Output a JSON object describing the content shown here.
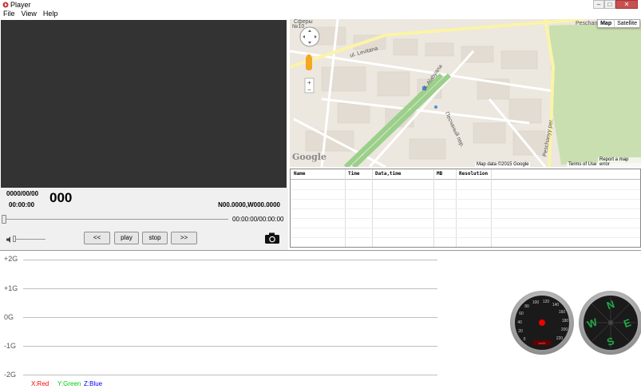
{
  "window": {
    "title": "Player",
    "icon": "player-app-icon",
    "controls": [
      "minimize",
      "maximize",
      "close"
    ]
  },
  "menu": {
    "items": [
      "File",
      "View",
      "Help"
    ]
  },
  "overlay": {
    "date": "0000/00/00",
    "time": "00:00:00",
    "counter": "000",
    "coords": "N00.0000,W000.0000"
  },
  "playback": {
    "timecode": "00:00:00/00:00:00",
    "prev_label": "<<",
    "play_label": "play",
    "stop_label": "stop",
    "next_label": ">>",
    "volume_icon": "speaker-icon",
    "snapshot_icon": "camera-icon"
  },
  "map": {
    "type_map": "Map",
    "type_satellite": "Satellite",
    "logo": "Google",
    "data_credit": "Map data ©2015 Google",
    "terms": "Terms of Use",
    "report": "Report a map error",
    "labels": {
      "street1": "ul. Levitana",
      "street2": "ul. Alabyana",
      "street3": "Песчаный пер.",
      "street4": "Peschanyy per.",
      "street5": "Peschanaya",
      "street6": "Сферы",
      "street7": "№10"
    }
  },
  "table": {
    "columns": [
      "Name",
      "Time",
      "Data,time",
      "MB",
      "Resolution"
    ]
  },
  "gsensor": {
    "labels": [
      "+2G",
      "+1G",
      "0G",
      "-1G",
      "-2G"
    ],
    "legend": [
      {
        "text": "X:Red",
        "color": "#ff0000"
      },
      {
        "text": "Y:Green",
        "color": "#00cc00"
      },
      {
        "text": "Z:Blue",
        "color": "#0000ff"
      }
    ]
  },
  "speedometer": {
    "ticks": [
      "0",
      "20",
      "40",
      "60",
      "80",
      "100",
      "120",
      "140",
      "160",
      "180",
      "200",
      "220"
    ],
    "unit": "km/h"
  },
  "compass": {
    "letters": [
      "N",
      "E",
      "S",
      "W"
    ],
    "color": "#22aa44"
  }
}
